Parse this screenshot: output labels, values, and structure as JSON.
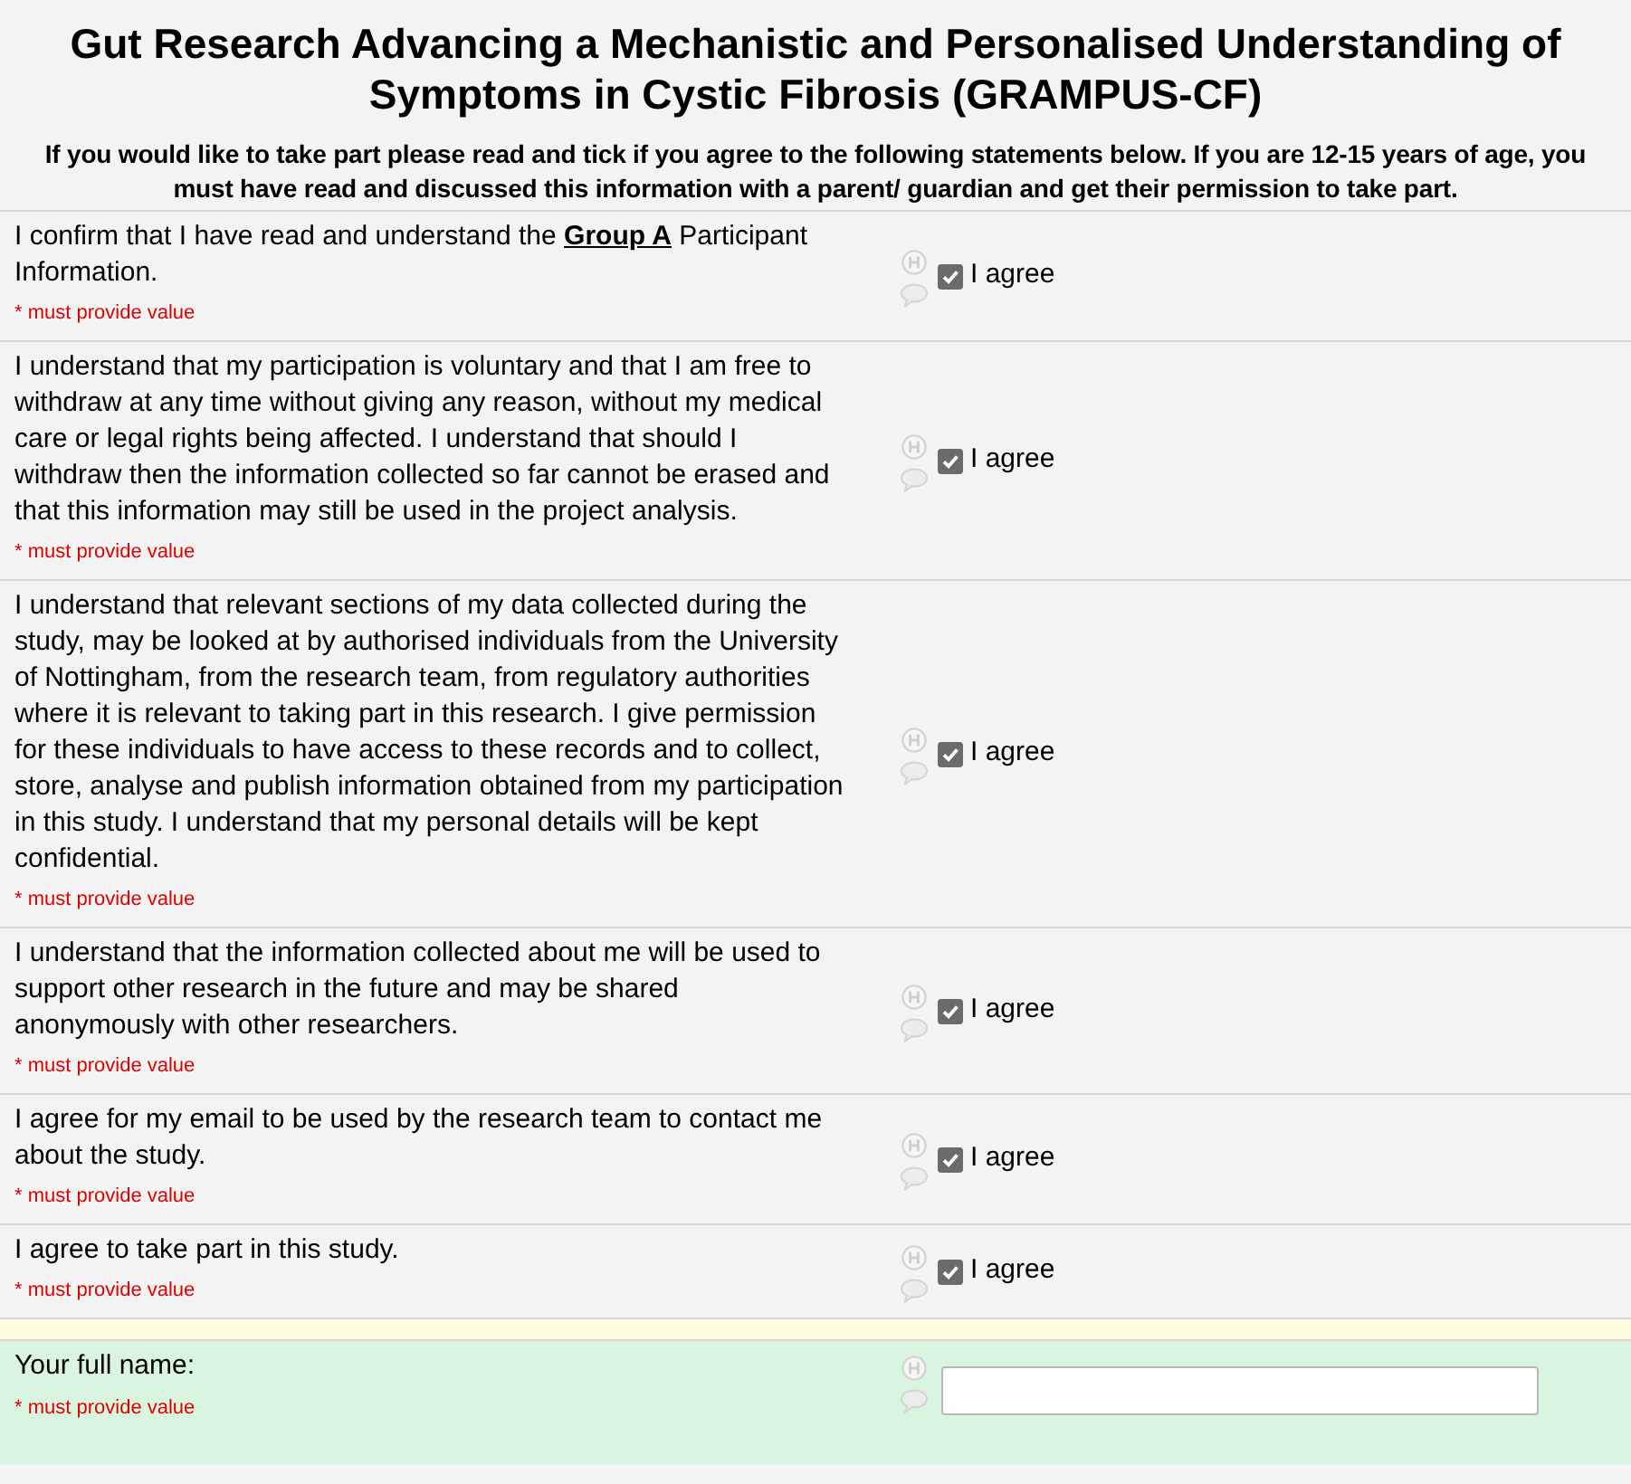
{
  "title": "Gut Research Advancing a Mechanistic and Personalised Understanding of Symptoms in Cystic Fibrosis (GRAMPUS-CF)",
  "instructions": "If you would like to take part please read and tick if you agree to the following statements below. If you are 12-15 years of age, you must have read and discussed this information with a parent/ guardian and get their permission to take part.",
  "statements": [
    {
      "text": "I confirm that I have read and understand the **Group A** Participant Information.",
      "required_note": "* must provide value",
      "option": "I agree",
      "checked": true
    },
    {
      "text": "I understand that my participation is voluntary and that I am free to withdraw at any time without giving any reason, without my medical care or legal rights being affected. I understand that should I withdraw then the information collected so far cannot be erased and that this information may still be used in the project analysis.",
      "required_note": "* must provide value",
      "option": "I agree",
      "checked": true
    },
    {
      "text": "I understand that relevant sections of my data collected during the study, may be looked at by authorised individuals from the University of Nottingham, from the research team, from regulatory authorities where it is relevant to taking part in this research. I give permission for these individuals to have access to these records and to collect, store, analyse and publish information obtained from my participation in this study. I understand that my personal details will be kept confidential.",
      "required_note": "* must provide value",
      "option": "I agree",
      "checked": true
    },
    {
      "text": "I understand that the information collected about me will be used to support other research in the future and may be shared anonymously with other researchers.",
      "required_note": "* must provide value",
      "option": "I agree",
      "checked": true
    },
    {
      "text": "I agree for my email to be used by the research team to contact me about the study.",
      "required_note": "* must provide value",
      "option": "I agree",
      "checked": true
    },
    {
      "text": "I agree to take part in this study.",
      "required_note": "* must provide value",
      "option": "I agree",
      "checked": true
    }
  ],
  "name_field": {
    "label": "Your full name:",
    "required_note": "* must provide value"
  }
}
